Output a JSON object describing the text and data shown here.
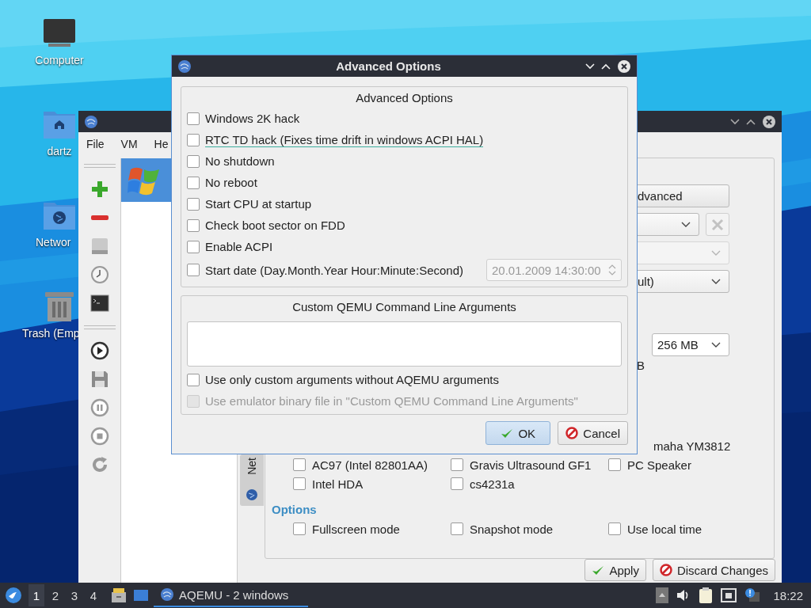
{
  "desktop": {
    "icons": [
      {
        "label": "Computer",
        "kind": "computer"
      },
      {
        "label": "dartz",
        "kind": "home"
      },
      {
        "label": "Networ",
        "kind": "network"
      },
      {
        "label": "Trash (Emp",
        "kind": "trash"
      }
    ]
  },
  "main_window": {
    "menu": [
      {
        "label": "File"
      },
      {
        "label": "VM"
      },
      {
        "label": "He"
      }
    ],
    "vm_list": [
      {
        "selected": true
      }
    ],
    "side_tab": {
      "label": "Net"
    },
    "advanced_button": "dvanced",
    "combos": [
      {
        "disabled": false,
        "clear_button": {
          "disabled": true
        }
      },
      {
        "disabled": true
      },
      {
        "value": "ult)",
        "disabled": false
      }
    ],
    "memory": {
      "value": "256 MB",
      "unit": "B"
    },
    "sound_cards": [
      {
        "kind": "text",
        "label": "maha YM3812"
      },
      {
        "kind": "checkbox",
        "label": "AC97 (Intel 82801AA)",
        "checked": false
      },
      {
        "kind": "checkbox",
        "label": "Gravis Ultrasound GF1",
        "checked": false
      },
      {
        "kind": "checkbox",
        "label": "PC Speaker",
        "checked": false
      },
      {
        "kind": "checkbox",
        "label": "Intel HDA",
        "checked": false
      },
      {
        "kind": "checkbox",
        "label": "cs4231a",
        "checked": false
      }
    ],
    "options": {
      "title": "Options",
      "items": [
        {
          "label": "Fullscreen mode",
          "checked": false
        },
        {
          "label": "Snapshot mode",
          "checked": false
        },
        {
          "label": "Use local time",
          "checked": false
        }
      ]
    },
    "buttons": [
      {
        "label": "Apply",
        "kind": "apply"
      },
      {
        "label": "Discard Changes",
        "kind": "discard"
      }
    ]
  },
  "dialog": {
    "title": "Advanced Options",
    "group_title": "Advanced Options",
    "options": [
      {
        "label": "Windows 2K hack",
        "checked": false,
        "focused": false
      },
      {
        "label": "RTC TD hack (Fixes time drift in windows ACPI HAL)",
        "checked": false,
        "focused": true
      },
      {
        "label": "No shutdown",
        "checked": false,
        "focused": false
      },
      {
        "label": "No reboot",
        "checked": false,
        "focused": false
      },
      {
        "label": "Start CPU at startup",
        "checked": false,
        "focused": false
      },
      {
        "label": "Check boot sector on FDD",
        "checked": false,
        "focused": false
      },
      {
        "label": "Enable ACPI",
        "checked": false,
        "focused": false
      },
      {
        "label": "Start date (Day.Month.Year Hour:Minute:Second)",
        "checked": false,
        "focused": false,
        "date": {
          "value": "20.01.2009 14:30:00",
          "disabled": true
        }
      }
    ],
    "custom_args": {
      "title": "Custom QEMU Command Line Arguments",
      "options": [
        {
          "label": "Use only custom arguments without AQEMU arguments",
          "checked": false,
          "disabled": false
        },
        {
          "label": "Use emulator binary file in \"Custom QEMU Command Line Arguments\"",
          "checked": false,
          "disabled": true
        }
      ]
    },
    "buttons": [
      {
        "label": "OK",
        "kind": "ok",
        "default": true
      },
      {
        "label": "Cancel",
        "kind": "cancel",
        "default": false
      }
    ]
  },
  "taskbar": {
    "workspaces": [
      {
        "label": "1",
        "selected": true
      },
      {
        "label": "2",
        "selected": false
      },
      {
        "label": "3",
        "selected": false
      },
      {
        "label": "4",
        "selected": false
      }
    ],
    "tasks": [
      {
        "label": "AQEMU - 2 windows",
        "selected": true
      }
    ],
    "clock": "18:22"
  }
}
